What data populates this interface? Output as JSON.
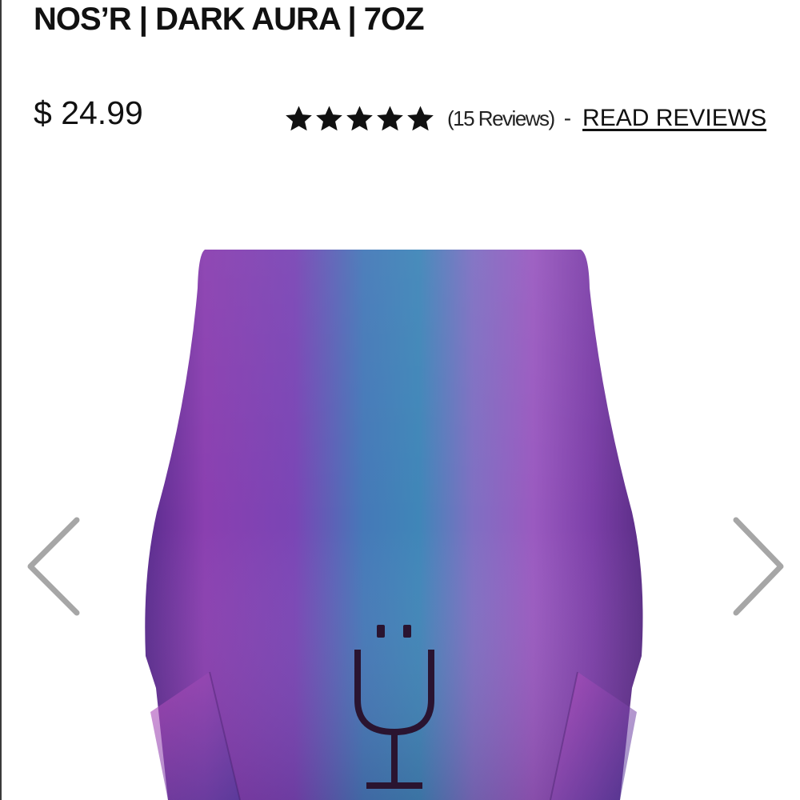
{
  "product": {
    "title": "NOS’R | DARK AURA | 7OZ",
    "price": "$ 24.99",
    "image_alt": "NOS’R Dark Aura tumbler",
    "colors": {
      "iridescent_purple": "#8a3fb0",
      "iridescent_blue": "#3f86b8",
      "logo": "#2a1430"
    }
  },
  "rating": {
    "stars": 5,
    "max_stars": 5,
    "count_label": "(15 Reviews)",
    "separator": "-",
    "read_reviews_label": "READ REVIEWS"
  },
  "carousel": {
    "prev_icon": "chevron-left-icon",
    "next_icon": "chevron-right-icon"
  }
}
